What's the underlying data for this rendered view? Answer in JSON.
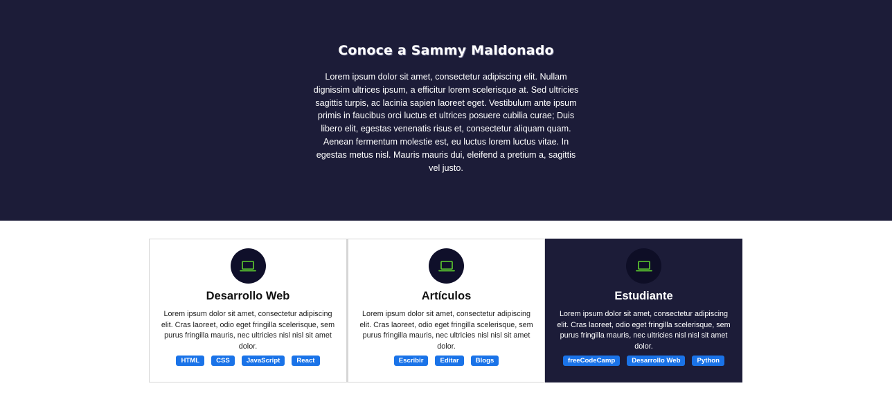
{
  "hero": {
    "title": "Conoce a Sammy Maldonado",
    "text": "Lorem ipsum dolor sit amet, consectetur adipiscing elit. Nullam dignissim ultrices ipsum, a efficitur lorem scelerisque at. Sed ultricies sagittis turpis, ac lacinia sapien laoreet eget. Vestibulum ante ipsum primis in faucibus orci luctus et ultrices posuere cubilia curae; Duis libero elit, egestas venenatis risus et, consectetur aliquam quam. Aenean fermentum molestie est, eu luctus lorem luctus vitae. In egestas metus nisl. Mauris mauris dui, eleifend a pretium a, sagittis vel justo."
  },
  "colors": {
    "hero_bg": "#1c1c38",
    "icon_green": "#5ecf2f",
    "tag_blue": "#1a73e8"
  },
  "cards": [
    {
      "icon": "laptop-icon",
      "title": "Desarrollo Web",
      "text": "Lorem ipsum dolor sit amet, consectetur adipiscing elit. Cras laoreet, odio eget fringilla scelerisque, sem purus fringilla mauris, nec ultricies nisl nisl sit amet dolor.",
      "tags": [
        "HTML",
        "CSS",
        "JavaScript",
        "React"
      ]
    },
    {
      "icon": "laptop-icon",
      "title": "Artículos",
      "text": "Lorem ipsum dolor sit amet, consectetur adipiscing elit. Cras laoreet, odio eget fringilla scelerisque, sem purus fringilla mauris, nec ultricies nisl nisl sit amet dolor.",
      "tags": [
        "Escribir",
        "Editar",
        "Blogs"
      ]
    },
    {
      "icon": "laptop-icon",
      "title": "Estudiante",
      "text": "Lorem ipsum dolor sit amet, consectetur adipiscing elit. Cras laoreet, odio eget fringilla scelerisque, sem purus fringilla mauris, nec ultricies nisl nisl sit amet dolor.",
      "tags": [
        "freeCodeCamp",
        "Desarrollo Web",
        "Python"
      ]
    }
  ]
}
